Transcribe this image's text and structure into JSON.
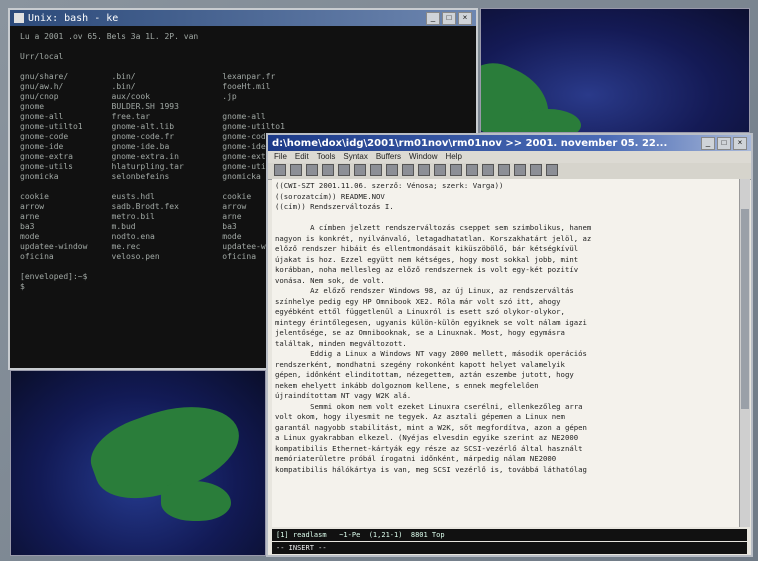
{
  "terminal": {
    "title": "Unix: bash - ke",
    "lines": [
      "Lu a 2001 .ov 65. Bels 3a 1L. 2P. van",
      "",
      "Urr/local",
      "",
      "gnu/share/         .bin/                  lexanpar.fr",
      "gnu/aw.h/          .bin/                  fooeHt.mil",
      "gnu/cnop           aux/cook               .jp",
      "gnome              BULDER.SH 1993",
      "gnome-all          free.tar               gnome-all",
      "gnome-utilto1      gnome-alt.lib          gnome-utilto1",
      "gnome-code         gnome-code.fr          gnome-code",
      "gnome-ide          gnome-ide.ba           gnome-ide",
      "gnome-extra        gnome-extra.in         gnome-extra",
      "gnome-utils        hlaturpling.tar        gnome-utils",
      "gnomicka           selonbefeins           gnomicka",
      "",
      "cookie             eusts.hdl              cookie",
      "arrow              sadb.Brodt.fex         arrow",
      "arne               metro.bil              arne",
      "ba3                m.bud                  ba3",
      "mode               nodto.ena              mode",
      "updatee-window     me.rec                 updatee-window",
      "oficina            veloso.pen             oficina",
      "",
      "[enveloped]:~$",
      "$"
    ]
  },
  "editor": {
    "title": "d:\\home\\dox\\idg\\2001\\rm01nov\\rm01nov >> 2001. november 05. 22...",
    "menu": [
      "File",
      "Edit",
      "Tools",
      "Syntax",
      "Buffers",
      "Window",
      "Help"
    ],
    "text_lines": [
      "((CWI-SZT 2001.11.06. szerző: Vénosa; szerk: Varga))",
      "((sorozatcím)) README.NOV",
      "((cím)) Rendszerváltozás I.",
      "",
      "        A címben jelzett rendszerváltozás cseppet sem szimbolikus, hanem",
      "nagyon is konkrét, nyilvánvaló, letagadhatatlan. Korszakhatárt jelöl, az",
      "előző rendszer hibáit és ellentmondásait kiküszöbölő, bár kétségkívül",
      "újakat is hoz. Ezzel együtt nem kétséges, hogy most sokkal jobb, mint",
      "korábban, noha mellesleg az előző rendszernek is volt egy-két pozitív",
      "vonása. Nem sok, de volt.",
      "        Az előző rendszer Windows 98, az új Linux, az rendszerváltás",
      "színhelye pedig egy HP Omnibook XE2. Róla már volt szó itt, ahogy",
      "egyébként ettől függetlenül a Linuxról is esett szó olykor-olykor,",
      "mintegy érintőlegesen, ugyanis külön-külön egyiknek se volt nálam igazi",
      "jelentősége, se az Omnibooknak, se a Linuxnak. Most, hogy egymásra",
      "találtak, minden megváltozott.",
      "        Eddig a Linux a Windows NT vagy 2000 mellett, második operációs",
      "rendszerként, mondhatni szegény rokonként kapott helyet valamelyik",
      "gépen, időnként elinditottam, nézegettem, aztán eszembe jutott, hogy",
      "nekem ehelyett inkább dolgoznom kellene, s ennek megfelelően",
      "újraindítottam NT vagy W2K alá.",
      "        Semmi okom nem volt ezeket Linuxra cserélni, ellenkezőleg arra",
      "volt okom, hogy ilyesmit ne tegyek. Az asztali gépemen a Linux nem",
      "garantál nagyobb stabilitást, mint a W2K, sőt megfordítva, azon a gépen",
      "a Linux gyakrabban elkezel. (Nyéjas elvesdin egyike szerint az NE2000",
      "kompatibilis Ethernet-kártyák egy része az SCSI-vezérlő által használt",
      "memóriaterületre próbál írogatni időnként, márpedig nálam NE2000",
      "kompatibilis hálókártya is van, meg SCSI vezérlő is, továbbá láthatólag"
    ],
    "status_line": "[1] readlasm   ~1-Pe  (1,21-1)  8801 Top",
    "mode_line": "-- INSERT --"
  }
}
